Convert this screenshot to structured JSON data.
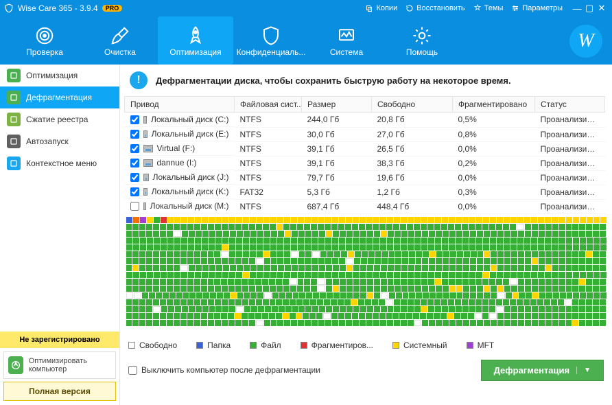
{
  "title": "Wise Care 365 - 3.9.4",
  "pro": "PRO",
  "titlebar": {
    "copies": "Копии",
    "restore": "Восстановить",
    "themes": "Темы",
    "params": "Параметры"
  },
  "topnav": {
    "check": "Проверка",
    "clean": "Очистка",
    "optimize": "Оптимизация",
    "privacy": "Конфиденциаль...",
    "system": "Система",
    "help": "Помощь",
    "activeIndex": 2
  },
  "sidebar": {
    "items": [
      {
        "label": "Оптимизация",
        "icon": "#4caf50"
      },
      {
        "label": "Дефрагментация",
        "icon": "#4caf50"
      },
      {
        "label": "Сжатие реестра",
        "icon": "#7cb342"
      },
      {
        "label": "Автозапуск",
        "icon": "#616161"
      },
      {
        "label": "Контекстное меню",
        "icon": "#1aa7ee"
      }
    ],
    "activeIndex": 1,
    "unregistered": "Не зарегистрировано",
    "optimizePC": "Оптимизировать компьютер",
    "fullVersion": "Полная версия"
  },
  "info": "Дефрагментации диска, чтобы сохранить быструю работу на некоторое время.",
  "columns": {
    "drive": "Привод",
    "fs": "Файловая сист...",
    "size": "Размер",
    "free": "Свободно",
    "frag": "Фрагментировано",
    "status": "Статус"
  },
  "drives": [
    {
      "checked": true,
      "name": "Локальный диск (C:)",
      "fs": "NTFS",
      "size": "244,0 Гб",
      "free": "20,8 Гб",
      "frag": "0,5%",
      "status": "Проанализировано"
    },
    {
      "checked": true,
      "name": "Локальный диск (E:)",
      "fs": "NTFS",
      "size": "30,0 Гб",
      "free": "27,0 Гб",
      "frag": "0,8%",
      "status": "Проанализировано"
    },
    {
      "checked": true,
      "name": "Virtual  (F:)",
      "fs": "NTFS",
      "size": "39,1 Гб",
      "free": "26,5 Гб",
      "frag": "0,0%",
      "status": "Проанализировано"
    },
    {
      "checked": true,
      "name": "dannue  (I:)",
      "fs": "NTFS",
      "size": "39,1 Гб",
      "free": "38,3 Гб",
      "frag": "0,2%",
      "status": "Проанализировано"
    },
    {
      "checked": true,
      "name": "Локальный диск (J:)",
      "fs": "NTFS",
      "size": "79,7 Гб",
      "free": "19,6 Гб",
      "frag": "0,0%",
      "status": "Проанализировано"
    },
    {
      "checked": true,
      "name": "Локальный диск (K:)",
      "fs": "FAT32",
      "size": "5,3 Гб",
      "free": "1,2 Гб",
      "frag": "0,3%",
      "status": "Проанализировано"
    },
    {
      "checked": false,
      "name": "Локальный диск (M:)",
      "fs": "NTFS",
      "size": "687,4 Гб",
      "free": "448,4 Гб",
      "frag": "0,0%",
      "status": "Проанализировано"
    }
  ],
  "legend": {
    "free": "Свободно",
    "folder": "Папка",
    "file": "Файл",
    "fragmented": "Фрагментиров...",
    "system": "Системный",
    "mft": "MFT"
  },
  "footer": {
    "shutdown": "Выключить компьютер после дефрагментации",
    "defragBtn": "Дефрагментация"
  }
}
